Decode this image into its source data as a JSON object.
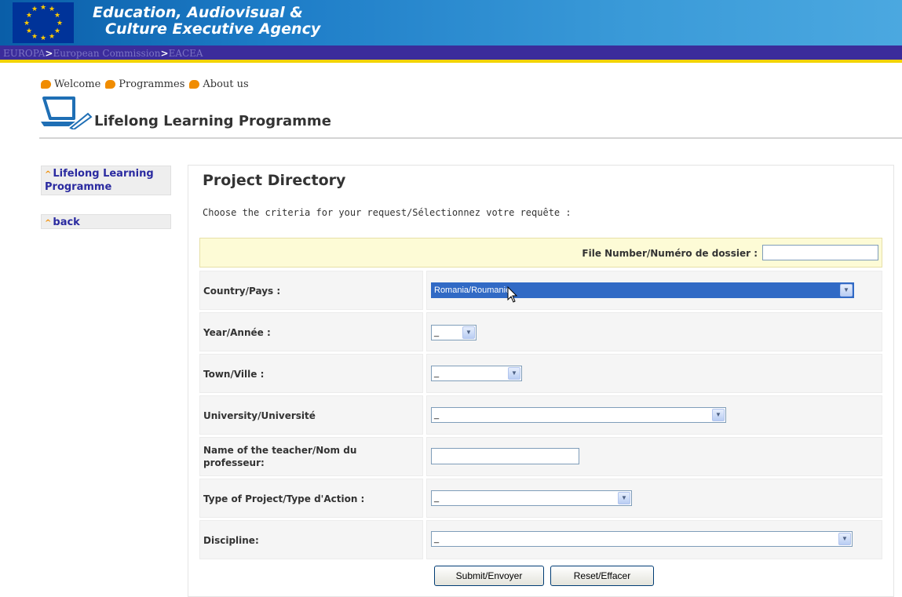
{
  "header": {
    "agency_line1": "Education, Audiovisual &",
    "agency_line2": "Culture Executive Agency",
    "breadcrumb": [
      "EUROPA",
      "European Commission",
      "EACEA"
    ],
    "breadcrumb_sep": ">"
  },
  "toplinks": [
    "Welcome",
    "Programmes",
    "About us"
  ],
  "program_title": "Lifelong Learning Programme",
  "sidebar": {
    "items": [
      {
        "label": "Lifelong Learning Programme"
      },
      {
        "label": "back"
      }
    ]
  },
  "main": {
    "title": "Project Directory",
    "criteria_text": "Choose the criteria for your request/Sélectionnez votre requête :",
    "file_number_label": "File Number/Numéro de dossier :",
    "file_number_value": "",
    "fields": {
      "country": {
        "label": "Country/Pays :",
        "value": "Romania/Roumanie"
      },
      "year": {
        "label": "Year/Année :",
        "value": "_"
      },
      "town": {
        "label": "Town/Ville :",
        "value": "_"
      },
      "university": {
        "label": "University/Université",
        "value": "_"
      },
      "teacher": {
        "label": "Name of the teacher/Nom du professeur:",
        "value": ""
      },
      "project_type": {
        "label": "Type of Project/Type d'Action :",
        "value": "_"
      },
      "discipline": {
        "label": "Discipline:",
        "value": "_"
      }
    },
    "buttons": {
      "submit": "Submit/Envoyer",
      "reset": "Reset/Effacer"
    }
  },
  "colors": {
    "banner": "#1d7cc7",
    "navbar": "#3b2c9b",
    "navbar_stripe": "#f2d300",
    "accent_orange": "#f08c00",
    "link_blue": "#2a2aa0",
    "selection_blue": "#316ac5"
  }
}
